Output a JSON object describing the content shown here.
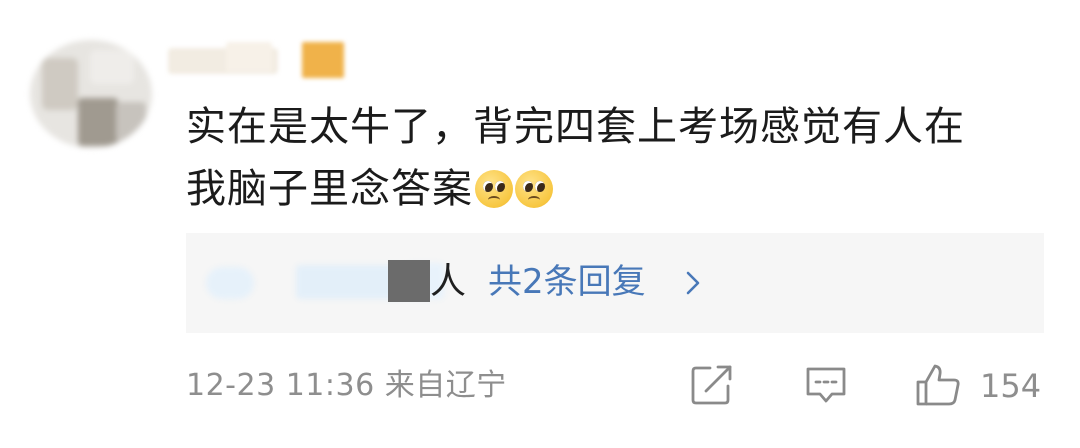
{
  "comment": {
    "text_line1": "实在是太牛了，背完四套上考场感觉有人在",
    "text_line2": "我脑子里念答案",
    "emojis": [
      "pleading-face-icon",
      "pleading-face-icon"
    ]
  },
  "replies": {
    "name_suffix": "人",
    "link_label": "共2条回复",
    "chevron": "chevron-right-icon"
  },
  "footer": {
    "timestamp": "12-23 11:36",
    "location": "来自辽宁",
    "like_count": "154",
    "icons": [
      "share-icon",
      "comment-icon",
      "thumbs-up-icon"
    ]
  },
  "colors": {
    "text": "#1b1b1b",
    "link": "#4878b8",
    "muted": "#8e8e8e",
    "reply_bg": "#f6f6f6",
    "emoji": "#f7c742"
  }
}
